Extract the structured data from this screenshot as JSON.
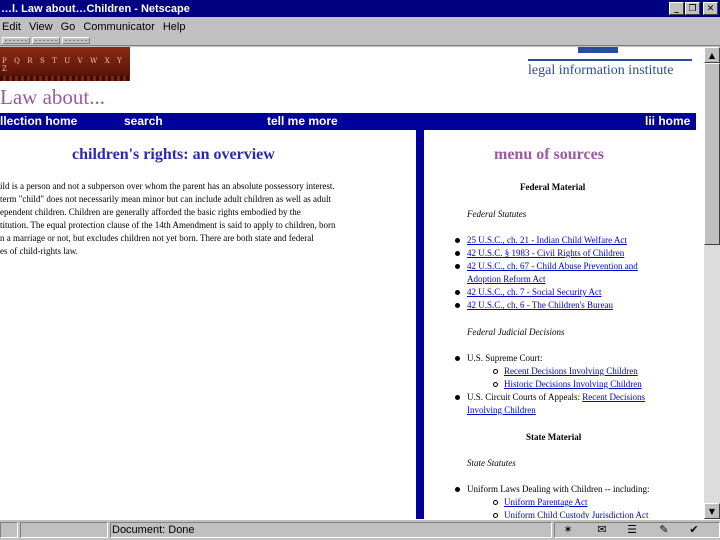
{
  "window": {
    "title": "…l. Law about…Children - Netscape"
  },
  "menu": [
    "Edit",
    "View",
    "Go",
    "Communicator",
    "Help"
  ],
  "header": {
    "alphabet": "P Q R S T U V W X Y Z",
    "lii_name": "legal information institute",
    "page_title": "Law about..."
  },
  "nav": {
    "collection_home": "llection home",
    "search": "search",
    "tell_me_more": "tell me more",
    "lii_home": "lii home"
  },
  "left": {
    "heading": "children's rights: an overview",
    "lines": [
      "ild is a person and not a subperson over whom the parent has an absolute possessory interest.",
      "term \"child\" does not necessarily mean minor but can include adult children as well as adult",
      "ependent children. Children are generally afforded the basic rights embodied by the",
      "titution. The equal protection clause of the 14th Amendment is said to apply to children, born",
      "n a marriage or not, but excludes children not yet born. There are both state and federal",
      "es of child-rights law."
    ]
  },
  "right": {
    "heading": "menu of sources",
    "federal_material": "Federal Material",
    "federal_statutes": "Federal Statutes",
    "statutes": [
      "25 U.S.C., ch. 21 - Indian Child Welfare Act",
      "42 U.S.C. § 1983 - Civil Rights of Children",
      "42 U.S.C., ch. 67 - Child Abuse Prevention and",
      "Adoption Reform Act",
      "42 U.S.C., ch. 7 - Social Security Act",
      "42 U.S.C., ch. 6 - The Children's Bureau"
    ],
    "federal_judicial": "Federal Judicial Decisions",
    "supreme_court": "U.S. Supreme Court:",
    "recent_decisions": "Recent Decisions Involving Children",
    "historic_decisions": "Historic Decisions Involving Children",
    "circuit_courts": "U.S. Circuit Courts of Appeals:",
    "recent_decisions_2": "Recent Decisions",
    "involving_children": "Involving Children",
    "state_material": "State Material",
    "state_statutes": "State Statutes",
    "uniform_laws": "Uniform Laws Dealing with Children -- including:",
    "uniform_parentage": "Uniform Parentage Act",
    "uniform_custody": "Uniform Child Custody Jurisdiction Act"
  },
  "status": {
    "text": "Document: Done"
  },
  "colors": {
    "nav_blue": "#00009a",
    "title_purple": "#9a5aa0",
    "heading_blue": "#2a2ab0",
    "link": "#0000cc"
  }
}
